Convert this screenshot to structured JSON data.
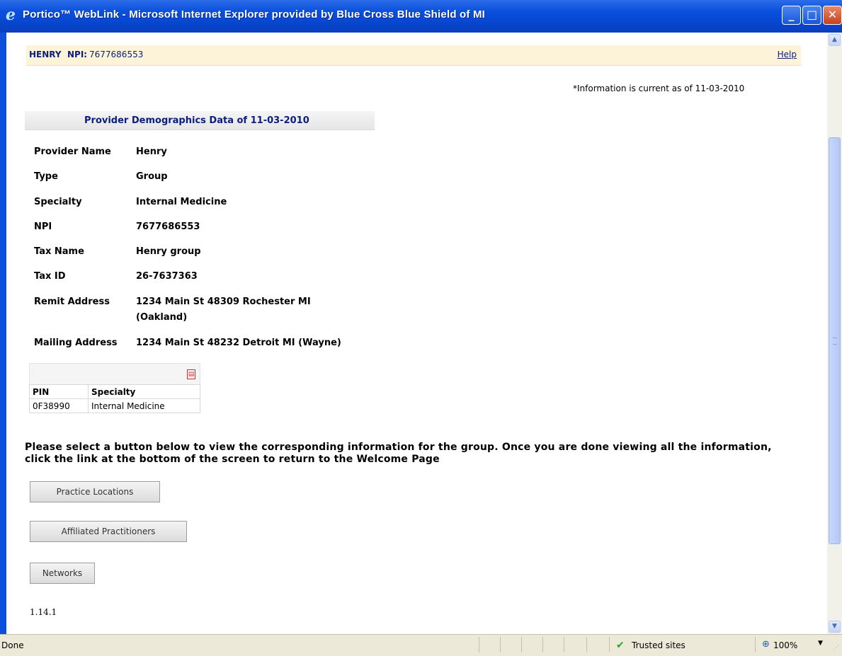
{
  "window": {
    "title": "Portico™ WebLink - Microsoft Internet Explorer provided by Blue Cross Blue Shield of MI",
    "ie_icon": "e",
    "min_glyph": "_",
    "max_glyph": "□",
    "close_glyph": "✕"
  },
  "header": {
    "name": "HENRY",
    "npi_label": "NPI:",
    "npi_value": "7677686553",
    "help": "Help"
  },
  "as_of": "*Information is current as of 11-03-2010",
  "section_title": "Provider Demographics Data of 11-03-2010",
  "demographics": [
    {
      "label": "Provider Name",
      "value": "Henry"
    },
    {
      "label": "Type",
      "value": "Group"
    },
    {
      "label": "Specialty",
      "value": "Internal Medicine"
    },
    {
      "label": "NPI",
      "value": "7677686553"
    },
    {
      "label": "Tax Name",
      "value": "Henry group"
    },
    {
      "label": "Tax ID",
      "value": "26-7637363"
    },
    {
      "label": "Remit Address",
      "value": "1234 Main St 48309 Rochester MI (Oakland)"
    },
    {
      "label": "Mailing Address",
      "value": "1234 Main St 48232 Detroit MI (Wayne)"
    }
  ],
  "pin_table": {
    "pdf_icon": "pdf-icon",
    "headers": [
      "PIN",
      "Specialty"
    ],
    "rows": [
      [
        "0F38990",
        "Internal Medicine"
      ]
    ]
  },
  "instructions": "Please select a button below to view the corresponding information for the group. Once you are done viewing all the information, click the link at the bottom of the screen to return to the Welcome Page",
  "buttons": {
    "practice": "Practice Locations",
    "affiliated": "Affiliated Practitioners",
    "networks": "Networks"
  },
  "version": "1.14.1",
  "statusbar": {
    "status": "Done",
    "zone": "Trusted sites",
    "zoom": "100%"
  }
}
